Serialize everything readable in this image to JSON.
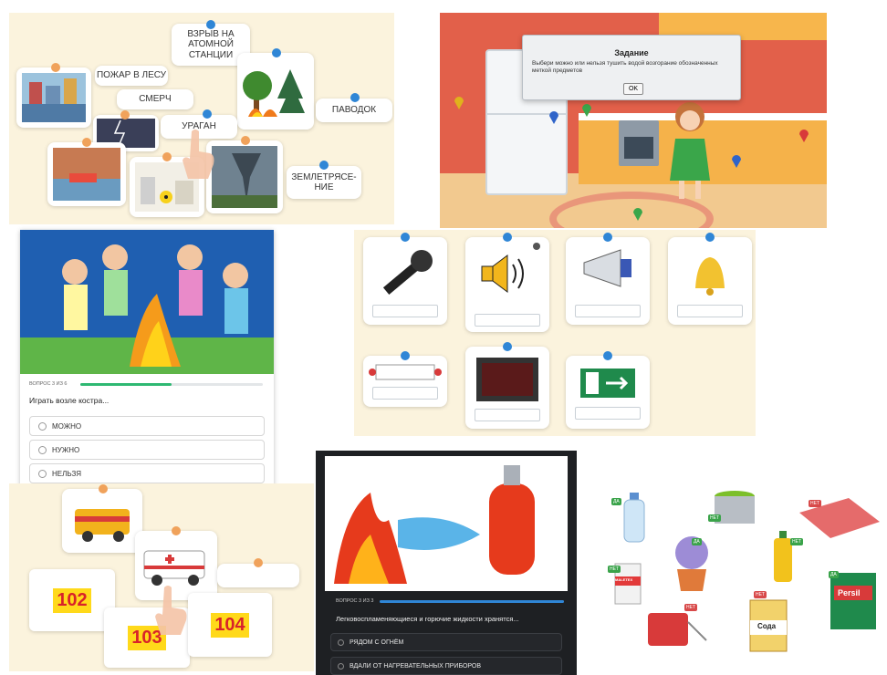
{
  "panel1": {
    "labels": {
      "explosion": "ВЗРЫВ НА АТОМНОЙ СТАНЦИИ",
      "forest_fire": "ПОЖАР В ЛЕСУ",
      "tornado": "СМЕРЧ",
      "hurricane": "УРАГАН",
      "flood": "ПАВОДОК",
      "earthquake": "ЗЕМЛЕТРЯСЕ-НИЕ"
    }
  },
  "panel2": {
    "dialog_title": "Задание",
    "dialog_text": "Выбери можно или нельзя тушить водой возгорание обозначенных меткой предметов",
    "ok_label": "OK"
  },
  "panel3": {
    "progress_text": "ВОПРОС 3 ИЗ 6",
    "progress": 0.5,
    "question": "Играть возле костра...",
    "options": [
      "МОЖНО",
      "НУЖНО",
      "НЕЛЬЗЯ"
    ]
  },
  "panel5": {
    "numbers": [
      "102",
      "103",
      "104"
    ]
  },
  "panel6": {
    "progress_text": "ВОПРОС 3 ИЗ 3",
    "progress": 1.0,
    "question": "Легковоспламеняющиеся и горючие жидкости хранятся...",
    "options": [
      "РЯДОМ С ОГНЁМ",
      "ВДАЛИ ОТ НАГРЕВАТЕЛЬНЫХ ПРИБОРОВ"
    ]
  },
  "panel7": {
    "tags": {
      "yes": "ДА",
      "no": "НЕТ"
    },
    "products": {
      "paint_brand": "MALETEX",
      "soda": "Сода",
      "persil": "Persil"
    }
  },
  "colors": {
    "board_bg": "#fbf3dd",
    "pin_blue": "#2f86d6",
    "pin_orange": "#f0a25b",
    "progress_green": "#2eb872",
    "progress_blue": "#2f86d6"
  }
}
